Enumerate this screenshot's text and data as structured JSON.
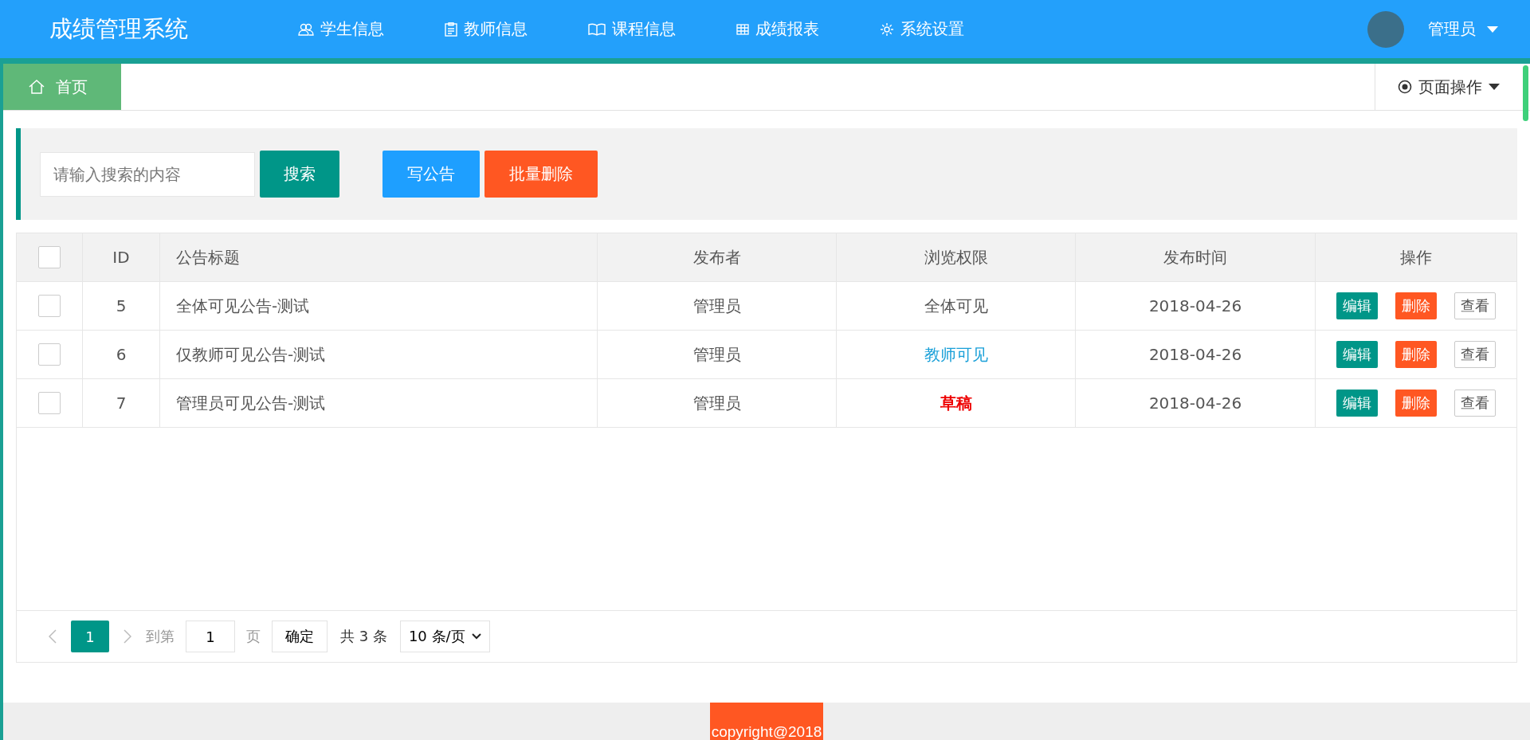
{
  "header": {
    "title": "成绩管理系统",
    "nav": [
      {
        "label": "学生信息",
        "kind": "users"
      },
      {
        "label": "教师信息",
        "kind": "clipboard"
      },
      {
        "label": "课程信息",
        "kind": "book"
      },
      {
        "label": "成绩报表",
        "kind": "grid"
      },
      {
        "label": "系统设置",
        "kind": "gear"
      }
    ],
    "user": "管理员"
  },
  "tabs": [
    {
      "label": "首页",
      "selected": true
    }
  ],
  "page_actions": "页面操作",
  "toolbar": {
    "search": {
      "placeholder": "请输入搜索的内容"
    },
    "search_button": "搜索",
    "write_button": "写公告",
    "delete_button": "批量删除"
  },
  "table": {
    "header_checked": false,
    "columns": [
      "ID",
      "公告标题",
      "发布者",
      "浏览权限",
      "发布时间",
      "操作"
    ],
    "rows": [
      {
        "checked": false,
        "id": "5",
        "title": "全体可见公告-测试",
        "publisher": "管理员",
        "visibility": {
          "text": "全体可见",
          "kind": "all"
        },
        "time": "2018-04-26",
        "actions": [
          "编辑",
          "删除",
          "查看"
        ]
      },
      {
        "checked": false,
        "id": "6",
        "title": "仅教师可见公告-测试",
        "publisher": "管理员",
        "visibility": {
          "text": "教师可见",
          "kind": "teacher"
        },
        "time": "2018-04-26",
        "actions": [
          "编辑",
          "删除",
          "查看"
        ]
      },
      {
        "checked": false,
        "id": "7",
        "title": "管理员可见公告-测试",
        "publisher": "管理员",
        "visibility": {
          "text": "草稿",
          "kind": "draft"
        },
        "time": "2018-04-26",
        "actions": [
          "编辑",
          "删除",
          "查看"
        ]
      }
    ]
  },
  "pagination": {
    "pages": [
      {
        "label": "1",
        "selected": true
      }
    ],
    "goto_label": "到第",
    "goto_value": "1",
    "page_label": "页",
    "confirm": "确定",
    "total": "共 3 条",
    "page_size": "10 条/页"
  },
  "footer": "copyright@2018"
}
